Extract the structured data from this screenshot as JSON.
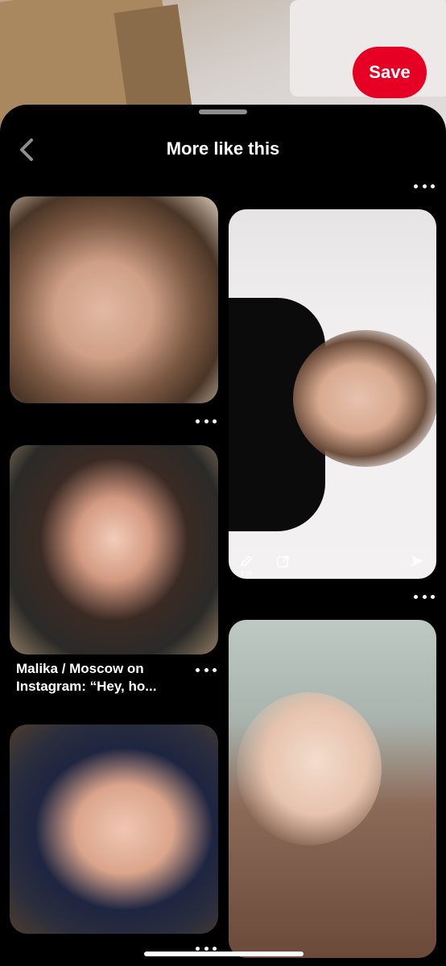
{
  "header": {
    "save_label": "Save"
  },
  "sheet": {
    "title": "More like this"
  },
  "pins": [
    {
      "id": "pin-1"
    },
    {
      "id": "pin-2",
      "tools": {
        "edit_label": "Edit"
      }
    },
    {
      "id": "pin-3",
      "caption": "Malika / Moscow on Instagram: “Hey, ho..."
    },
    {
      "id": "pin-4"
    },
    {
      "id": "pin-5"
    }
  ],
  "colors": {
    "save_button": "#e60023",
    "background": "#000000",
    "text": "#ffffff"
  },
  "icons": {
    "back": "chevron-left-icon",
    "more": "more-options-icon",
    "edit": "pencil-icon",
    "share": "share-icon",
    "send": "send-icon"
  }
}
